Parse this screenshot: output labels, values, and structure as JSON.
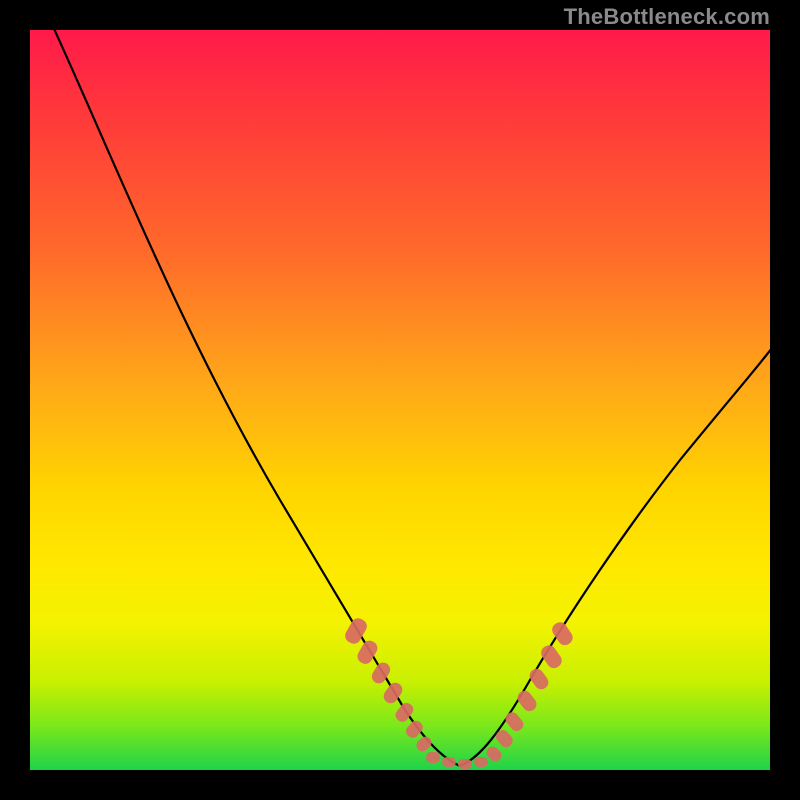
{
  "watermark": "TheBottleneck.com",
  "colors": {
    "background": "#000000",
    "gradient_top": "#ff1a4a",
    "gradient_mid1": "#ffa818",
    "gradient_mid2": "#ffe800",
    "gradient_bottom": "#1fd34a",
    "curve": "#000000",
    "markers": "#d86a63"
  },
  "chart_data": {
    "type": "line",
    "title": "",
    "xlabel": "",
    "ylabel": "",
    "xlim": [
      0,
      100
    ],
    "ylim": [
      0,
      100
    ],
    "grid": false,
    "legend": false,
    "series": [
      {
        "name": "left-curve",
        "x": [
          5,
          10,
          15,
          20,
          25,
          30,
          35,
          40,
          45,
          48,
          50,
          52,
          55,
          58
        ],
        "values": [
          100,
          92,
          83,
          73,
          62,
          50,
          38,
          27,
          17,
          11,
          7,
          4,
          2,
          1
        ]
      },
      {
        "name": "right-curve",
        "x": [
          58,
          60,
          63,
          66,
          70,
          75,
          80,
          85,
          90,
          95,
          100
        ],
        "values": [
          1,
          2,
          5,
          9,
          15,
          23,
          31,
          39,
          46,
          53,
          60
        ]
      }
    ],
    "marker_regions": [
      {
        "name": "left-markers",
        "x_range": [
          44,
          52
        ],
        "y_range": [
          3,
          18
        ]
      },
      {
        "name": "valley-markers",
        "x_range": [
          52,
          60
        ],
        "y_range": [
          1,
          3
        ]
      },
      {
        "name": "right-markers",
        "x_range": [
          60,
          70
        ],
        "y_range": [
          3,
          18
        ]
      }
    ]
  }
}
